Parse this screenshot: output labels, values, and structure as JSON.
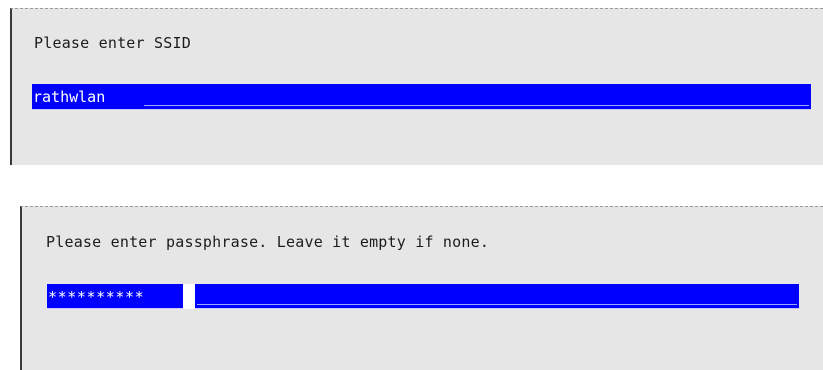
{
  "ssid_dialog": {
    "prompt": "Please enter SSID",
    "value": "rathwlan"
  },
  "passphrase_dialog": {
    "prompt": "Please enter passphrase. Leave it empty if none.",
    "value_masked": "**********"
  },
  "colors": {
    "panel_background": "#e6e6e6",
    "field_background": "#0000ff",
    "field_text": "#ffffff",
    "prompt_text": "#1c1c1c"
  }
}
